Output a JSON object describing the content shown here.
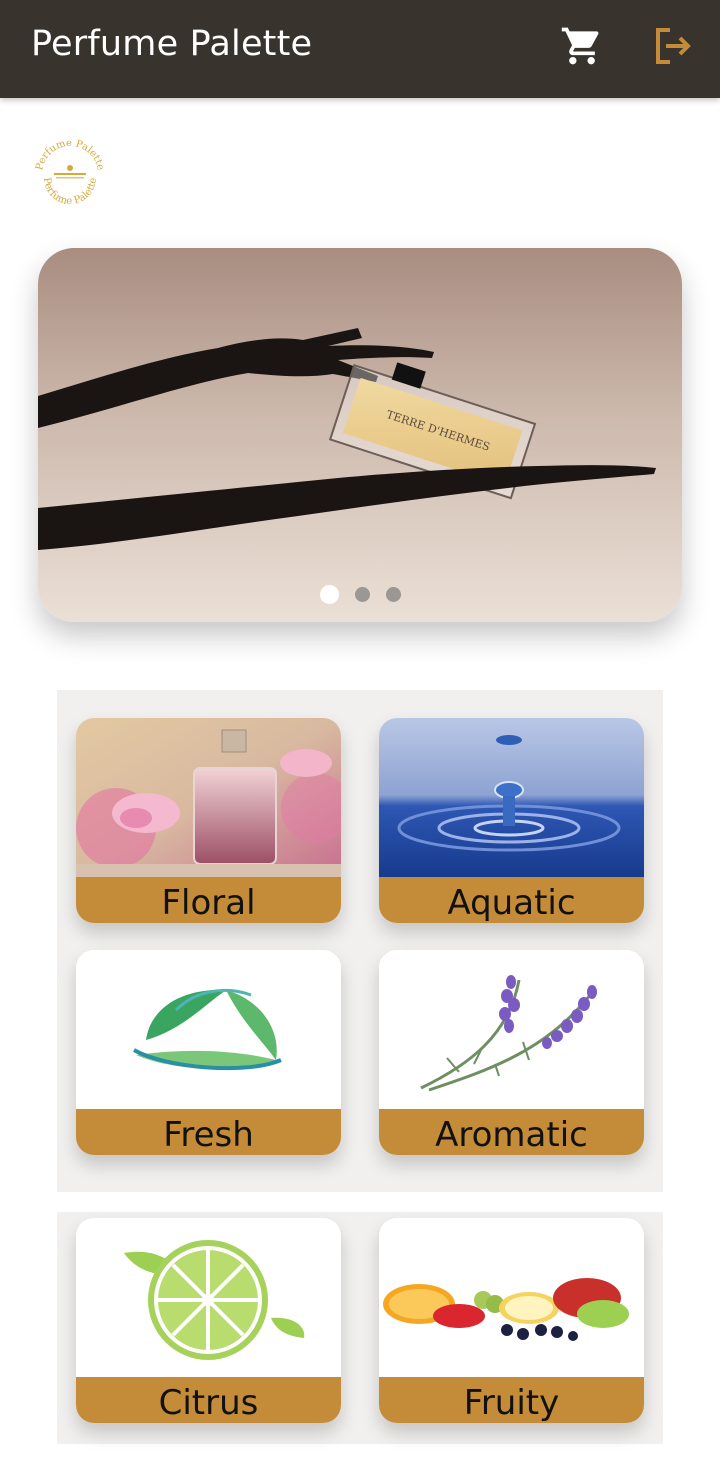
{
  "app": {
    "title": "Perfume Palette"
  },
  "header": {
    "cart_icon": "cart-icon",
    "logout_icon": "logout-icon"
  },
  "logo": {
    "text_top": "Perfume Palette",
    "text_bottom": "Perfume Palette"
  },
  "carousel": {
    "slide_count": 3,
    "active_index": 0,
    "bottle_text": "TERRE D'HERMES"
  },
  "categories": [
    {
      "label": "Floral"
    },
    {
      "label": "Aquatic"
    },
    {
      "label": "Fresh"
    },
    {
      "label": "Aromatic"
    },
    {
      "label": "Citrus"
    },
    {
      "label": "Fruity"
    }
  ],
  "colors": {
    "appbar": "#38342d",
    "accent": "#c48c38",
    "logo_gold": "#d4aa3c"
  }
}
